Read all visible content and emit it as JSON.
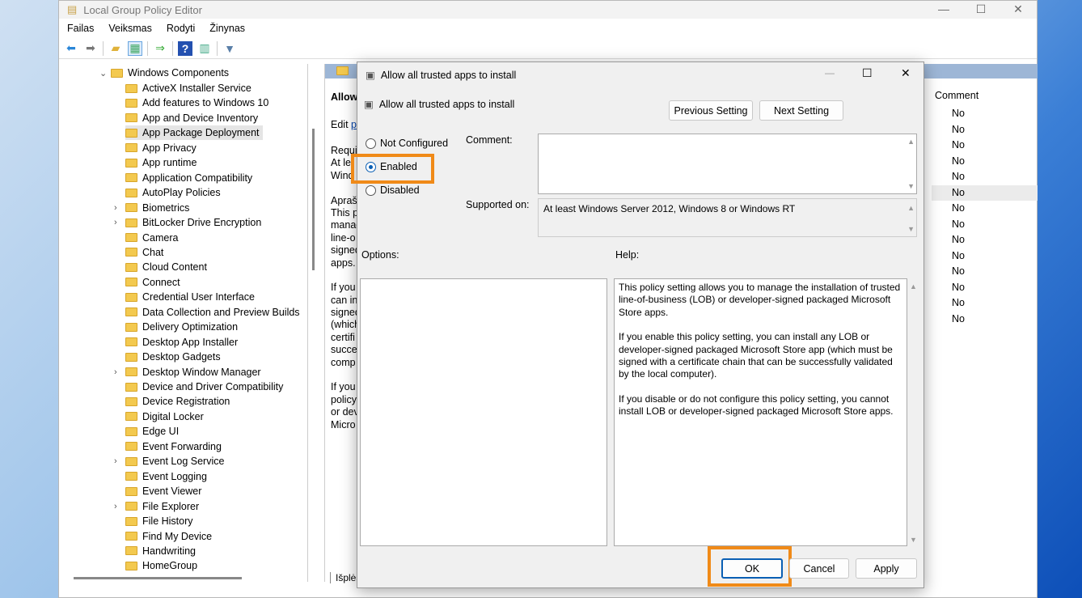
{
  "window": {
    "title": "Local Group Policy Editor",
    "minimize": "—",
    "maximize": "☐",
    "close": "✕"
  },
  "menu": [
    "Failas",
    "Veiksmas",
    "Rodyti",
    "Žinynas"
  ],
  "tree": {
    "root": "Windows Components",
    "items": [
      {
        "label": "ActiveX Installer Service",
        "exp": false
      },
      {
        "label": "Add features to Windows 10",
        "exp": false
      },
      {
        "label": "App and Device Inventory",
        "exp": false
      },
      {
        "label": "App Package Deployment",
        "exp": false,
        "selected": true
      },
      {
        "label": "App Privacy",
        "exp": false
      },
      {
        "label": "App runtime",
        "exp": false
      },
      {
        "label": "Application Compatibility",
        "exp": false
      },
      {
        "label": "AutoPlay Policies",
        "exp": false
      },
      {
        "label": "Biometrics",
        "exp": true
      },
      {
        "label": "BitLocker Drive Encryption",
        "exp": true
      },
      {
        "label": "Camera",
        "exp": false
      },
      {
        "label": "Chat",
        "exp": false
      },
      {
        "label": "Cloud Content",
        "exp": false
      },
      {
        "label": "Connect",
        "exp": false
      },
      {
        "label": "Credential User Interface",
        "exp": false
      },
      {
        "label": "Data Collection and Preview Builds",
        "exp": false
      },
      {
        "label": "Delivery Optimization",
        "exp": false
      },
      {
        "label": "Desktop App Installer",
        "exp": false
      },
      {
        "label": "Desktop Gadgets",
        "exp": false
      },
      {
        "label": "Desktop Window Manager",
        "exp": true
      },
      {
        "label": "Device and Driver Compatibility",
        "exp": false
      },
      {
        "label": "Device Registration",
        "exp": false
      },
      {
        "label": "Digital Locker",
        "exp": false
      },
      {
        "label": "Edge UI",
        "exp": false
      },
      {
        "label": "Event Forwarding",
        "exp": false
      },
      {
        "label": "Event Log Service",
        "exp": true
      },
      {
        "label": "Event Logging",
        "exp": false
      },
      {
        "label": "Event Viewer",
        "exp": false
      },
      {
        "label": "File Explorer",
        "exp": true
      },
      {
        "label": "File History",
        "exp": false
      },
      {
        "label": "Find My Device",
        "exp": false
      },
      {
        "label": "Handwriting",
        "exp": false
      },
      {
        "label": "HomeGroup",
        "exp": false
      }
    ]
  },
  "right_pane": {
    "title": "Allow",
    "edit": "Edit",
    "edit_link": "p",
    "lines": [
      "Requi",
      "At le",
      "Wind",
      "",
      "Aprašy",
      "This p",
      "manag",
      "line-o",
      "signed",
      "apps.",
      "",
      "If you",
      "can in",
      "signed",
      "(which",
      "certifi",
      "succes",
      "comp",
      "",
      "If you",
      "policy",
      "or dev",
      "Micro"
    ],
    "tab": "Išplės",
    "comment_header": "Comment",
    "comments": [
      "No",
      "No",
      "No",
      "No",
      "No",
      "No",
      "No",
      "No",
      "No",
      "No",
      "No",
      "No",
      "No",
      "No"
    ]
  },
  "dialog": {
    "title": "Allow all trusted apps to install",
    "heading": "Allow all trusted apps to install",
    "prev": "Previous Setting",
    "next": "Next Setting",
    "radios": [
      "Not Configured",
      "Enabled",
      "Disabled"
    ],
    "selected": "Enabled",
    "comment_label": "Comment:",
    "supported_label": "Supported on:",
    "supported_value": "At least Windows Server 2012, Windows 8 or Windows RT",
    "options_label": "Options:",
    "help_label": "Help:",
    "help": [
      "This policy setting allows you to manage the installation of trusted line-of-business (LOB) or developer-signed packaged Microsoft Store apps.",
      "If you enable this policy setting, you can install any LOB or developer-signed packaged Microsoft Store app (which must be signed with a certificate chain that can be successfully validated by the local computer).",
      "If you disable or do not configure this policy setting, you cannot install LOB or developer-signed packaged Microsoft Store apps."
    ],
    "ok": "OK",
    "cancel": "Cancel",
    "apply": "Apply"
  },
  "highlight_color": "#f08a18"
}
